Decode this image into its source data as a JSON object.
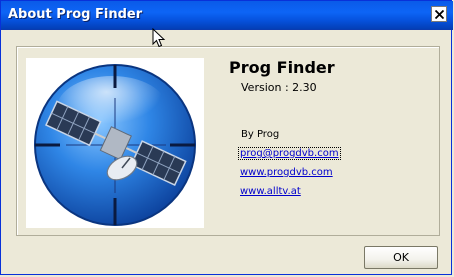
{
  "window": {
    "title": "About Prog Finder",
    "close_symbol": "×"
  },
  "about": {
    "app_name": "Prog Finder",
    "version": "Version : 2.30",
    "author": "By Prog",
    "email": "prog@progdvb.com",
    "website1": "www.progdvb.com",
    "website2": "www.alltv.at"
  },
  "buttons": {
    "ok_label": "OK"
  },
  "icons": {
    "logo": "satellite-globe-icon",
    "close": "close-icon",
    "cursor": "mouse-pointer-icon"
  },
  "colors": {
    "titlebar": "#0a5ae8",
    "background": "#ece9d8",
    "link": "#0000cc",
    "globe": "#1a6fd8"
  }
}
